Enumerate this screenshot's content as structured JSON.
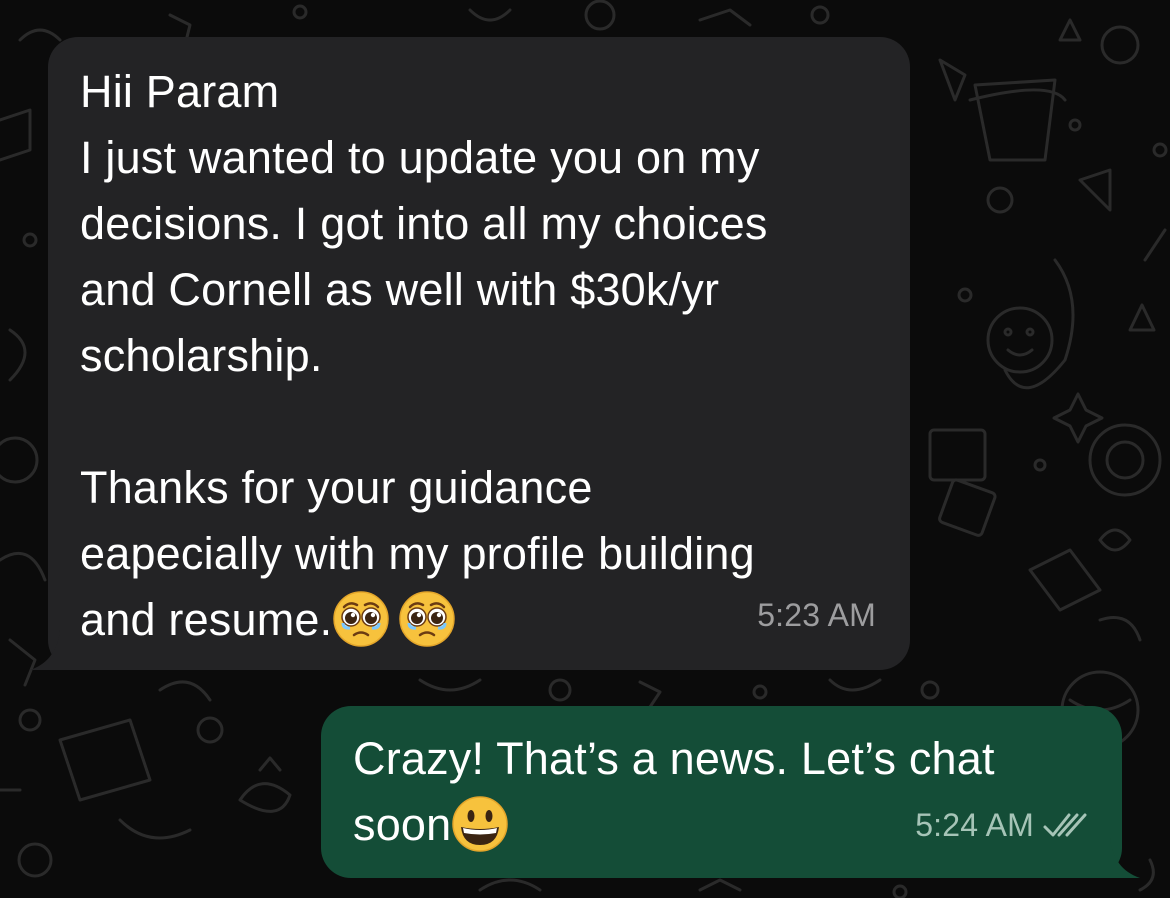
{
  "chat": {
    "messages": [
      {
        "direction": "incoming",
        "lines": [
          "Hii Param",
          "I just wanted to update you on my",
          "decisions. I got into all my choices",
          "and Cornell as well with $30k/yr",
          "scholarship.",
          "",
          "Thanks for your guidance",
          "eapecially with my profile building",
          "and resume."
        ],
        "emojis": [
          "pleading-face",
          "pleading-face"
        ],
        "time": "5:23 AM"
      },
      {
        "direction": "outgoing",
        "lines": [
          "Crazy! That’s a news. Let’s chat",
          "soon"
        ],
        "emojis": [
          "grinning-face"
        ],
        "time": "5:24 AM",
        "status_icon": "double-check-read-icon"
      }
    ]
  },
  "colors": {
    "background": "#0b0b0b",
    "incoming_bubble": "#232325",
    "outgoing_bubble": "#144d37",
    "text": "#ffffff",
    "timestamp_incoming": "#9d9d9f",
    "timestamp_outgoing": "#a6c4b7"
  }
}
